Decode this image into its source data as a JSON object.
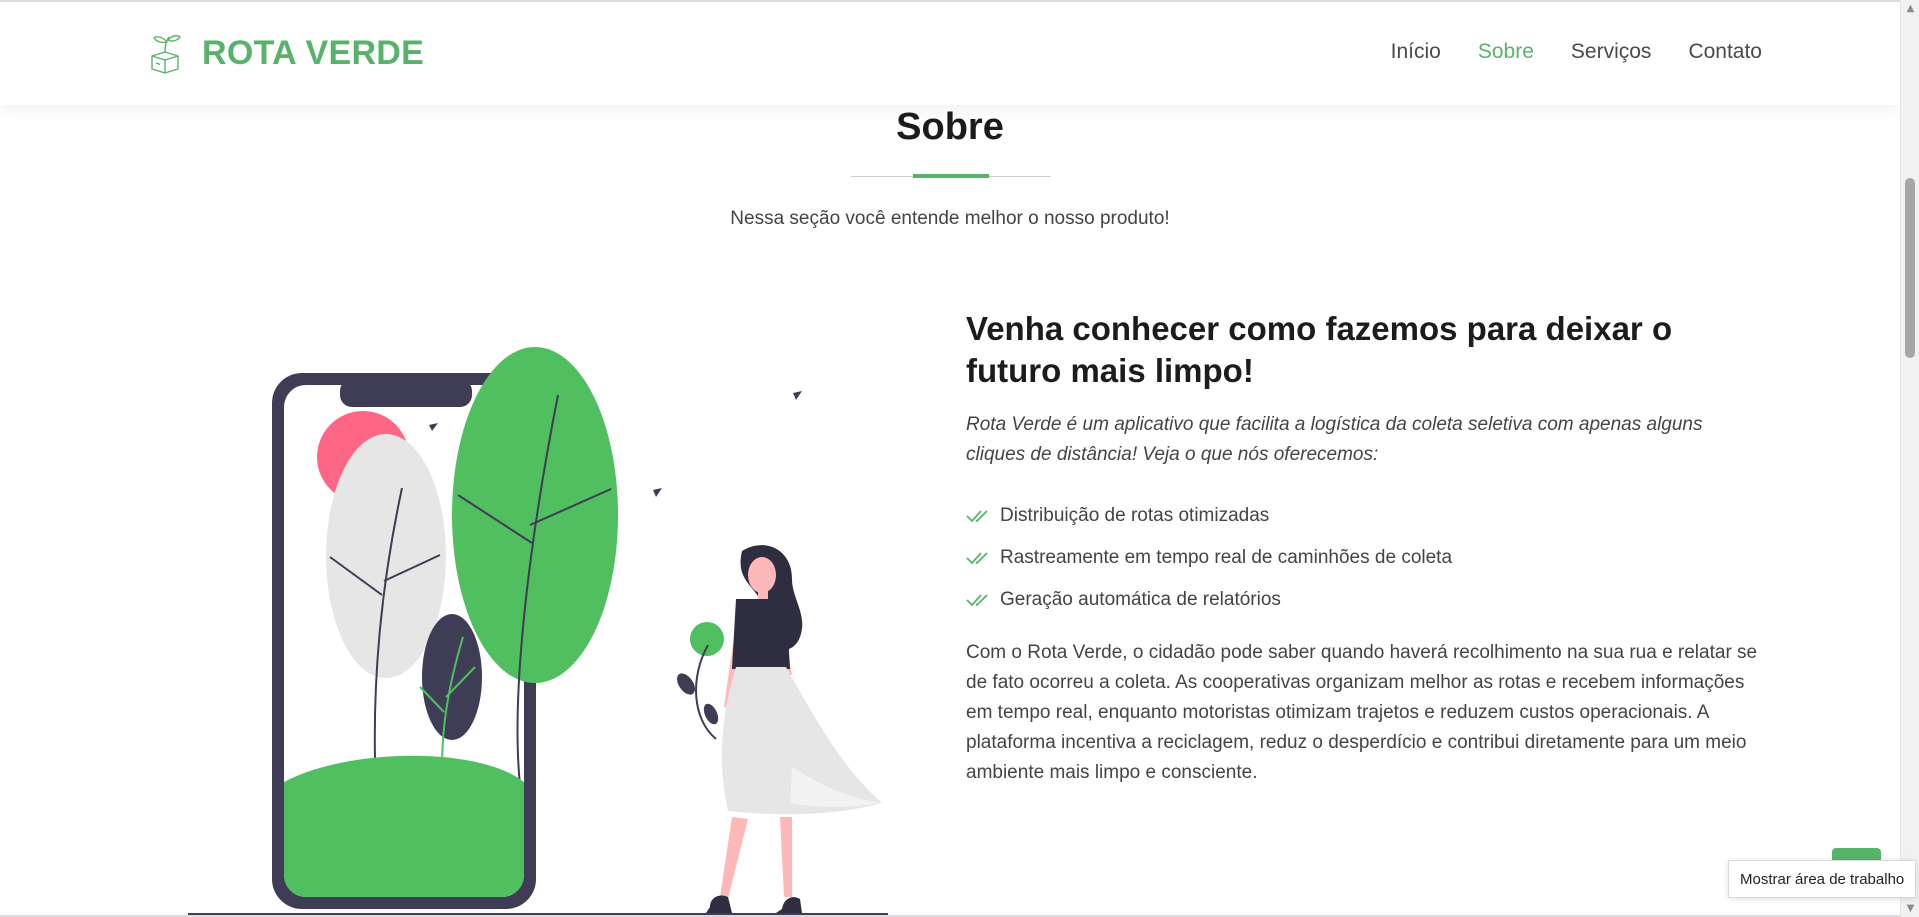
{
  "header": {
    "brand": "ROTA VERDE",
    "nav": [
      {
        "label": "Início",
        "active": false
      },
      {
        "label": "Sobre",
        "active": true
      },
      {
        "label": "Serviços",
        "active": false
      },
      {
        "label": "Contato",
        "active": false
      }
    ]
  },
  "section": {
    "title": "Sobre",
    "subtitle": "Nessa seção você entende melhor o nosso produto!"
  },
  "content": {
    "heading": "Venha conhecer como fazemos para deixar o futuro mais limpo!",
    "lead": "Rota Verde é um aplicativo que facilita a logística da coleta seletiva com apenas alguns cliques de distância! Veja o que nós oferecemos:",
    "features": [
      "Distribuição de rotas otimizadas",
      "Rastreamente em tempo real de caminhões de coleta",
      "Geração automática de relatórios"
    ],
    "body": "Com o Rota Verde, o cidadão pode saber quando haverá recolhimento na sua rua e relatar se de fato ocorreu a coleta. As cooperativas organizam melhor as rotas e recebem informações em tempo real, enquanto motoristas otimizam trajetos e reduzem custos operacionais. A plataforma incentiva a reciclagem, reduz o desperdício e contribui diretamente para um meio ambiente mais limpo e consciente."
  },
  "tooltip": "Mostrar área de trabalho",
  "colors": {
    "accent": "#57b36a",
    "illustration_green": "#4fbf5f",
    "illustration_dark": "#3f3d56",
    "illustration_pink": "#ff6584"
  },
  "icons": {
    "logo": "plant-box-icon",
    "feature_bullet": "double-check-icon",
    "scroll_up": "triangle-up-icon",
    "scroll_down": "triangle-down-icon"
  }
}
